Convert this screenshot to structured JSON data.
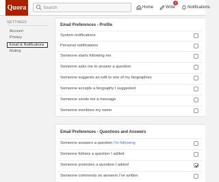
{
  "header": {
    "logo": "Quora",
    "search_placeholder": "Search",
    "nav": [
      {
        "label": "Home",
        "icon": "home-icon"
      },
      {
        "label": "Write",
        "icon": "pencil-icon",
        "badge": "2"
      },
      {
        "label": "Notifications",
        "icon": "bell-icon"
      }
    ]
  },
  "sidebar": {
    "title": "SETTINGS",
    "items": [
      {
        "label": "Account",
        "active": false
      },
      {
        "label": "Privacy",
        "active": false
      },
      {
        "label": "Email & Notifications",
        "active": true
      },
      {
        "label": "Muting",
        "active": false
      }
    ]
  },
  "sections": [
    {
      "title": "Email Preferences - Profile",
      "rows": [
        {
          "label": "System notifications",
          "checked": false
        },
        {
          "label": "Personal notifications",
          "checked": false
        },
        {
          "label": "Someone starts following me",
          "checked": false
        },
        {
          "label": "Someone asks me to answer a question",
          "checked": false
        },
        {
          "label": "Someone suggests an edit to one of my biographies",
          "checked": false
        },
        {
          "label": "Someone accepts a biography I suggested",
          "checked": false
        },
        {
          "label": "Someone sends me a message",
          "checked": false
        },
        {
          "label": "Someone mentions my name",
          "checked": false
        }
      ]
    },
    {
      "title": "Email Preferences - Questions and Answers",
      "rows": [
        {
          "label": "Someone answers a question ",
          "link": "I'm following",
          "checked": false
        },
        {
          "label": "Someone follows a question I added",
          "checked": false
        },
        {
          "label": "Someone promotes a question I added",
          "checked": true
        },
        {
          "label": "Someone comments on answers I've written",
          "checked": false
        }
      ]
    }
  ],
  "colors": {
    "brand": "#a82400",
    "badge": "#cc3333",
    "link": "#4a70b0"
  }
}
